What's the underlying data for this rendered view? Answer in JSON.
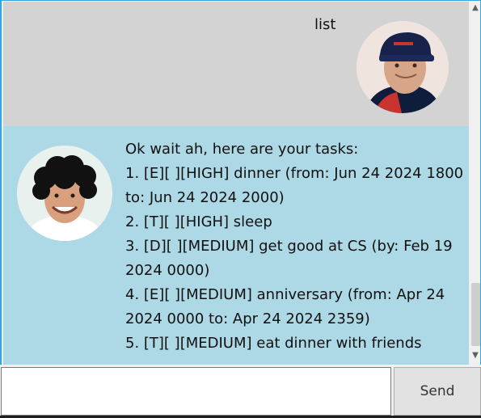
{
  "chat": {
    "user_message": "list",
    "bot_lines": [
      "Ok wait ah, here are your tasks:",
      "1. [E][ ][HIGH] dinner (from: Jun 24 2024 1800",
      "to: Jun 24 2024 2000)",
      "2. [T][ ][HIGH] sleep",
      "3. [D][ ][MEDIUM] get good at CS (by: Feb 19",
      "2024 0000)",
      "4. [E][ ][MEDIUM] anniversary (from: Apr 24",
      "2024 0000 to: Apr 24 2024 2359)",
      "5. [T][ ][MEDIUM] eat dinner with friends"
    ]
  },
  "scrollbar": {
    "up_icon": "▲",
    "down_icon": "▼"
  },
  "input": {
    "value": "",
    "placeholder": ""
  },
  "send_button": {
    "label": "Send"
  },
  "colors": {
    "user_row_bg": "#d3d3d3",
    "bot_row_bg": "#add8e6",
    "frame_accent": "#33a7dd"
  }
}
